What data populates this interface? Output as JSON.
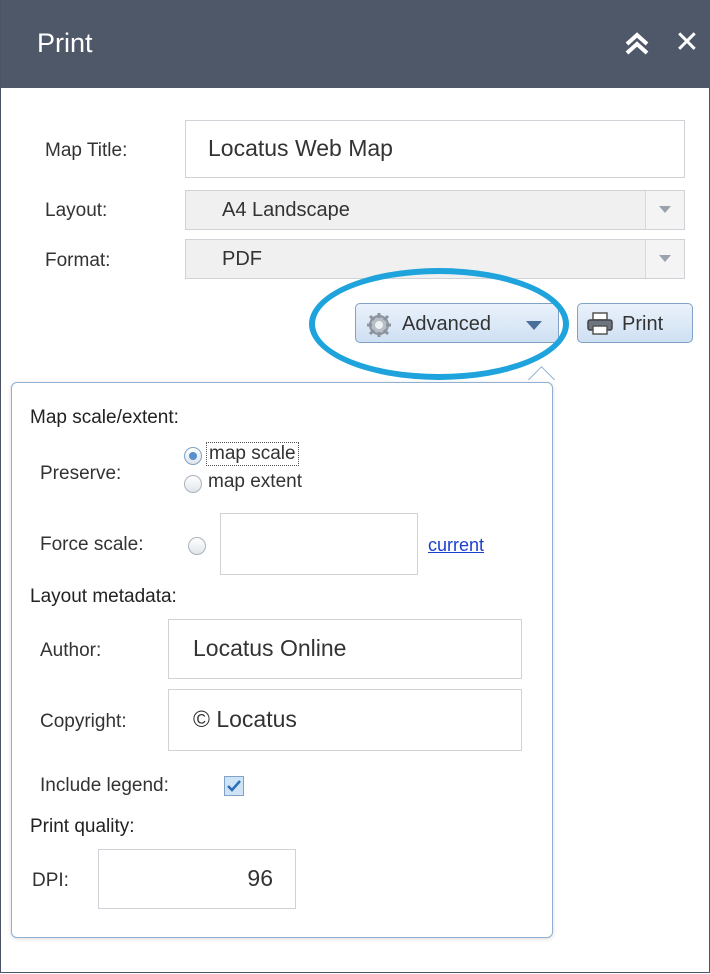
{
  "window": {
    "title": "Print",
    "collapse_icon": "double-chevron-up-icon",
    "close_glyph": "✕"
  },
  "form": {
    "map_title_label": "Map Title:",
    "map_title_value": "Locatus Web Map",
    "layout_label": "Layout:",
    "layout_value": "A4 Landscape",
    "format_label": "Format:",
    "format_value": "PDF"
  },
  "buttons": {
    "advanced_label": "Advanced",
    "print_label": "Print"
  },
  "advanced": {
    "map_scale_heading": "Map scale/extent:",
    "preserve_label": "Preserve:",
    "preserve_options": [
      "map scale",
      "map extent"
    ],
    "preserve_selected": "map scale",
    "force_scale_label": "Force scale:",
    "force_scale_value": "",
    "current_link": "current",
    "layout_metadata_heading": "Layout metadata:",
    "author_label": "Author:",
    "author_value": "Locatus Online",
    "copyright_label": "Copyright:",
    "copyright_value": "© Locatus",
    "include_legend_label": "Include legend:",
    "include_legend_checked": true,
    "print_quality_heading": "Print quality:",
    "dpi_label": "DPI:",
    "dpi_value": "96"
  },
  "colors": {
    "titlebar": "#4f5868",
    "highlight": "#1ea3dc",
    "link": "#1a3fd0"
  }
}
